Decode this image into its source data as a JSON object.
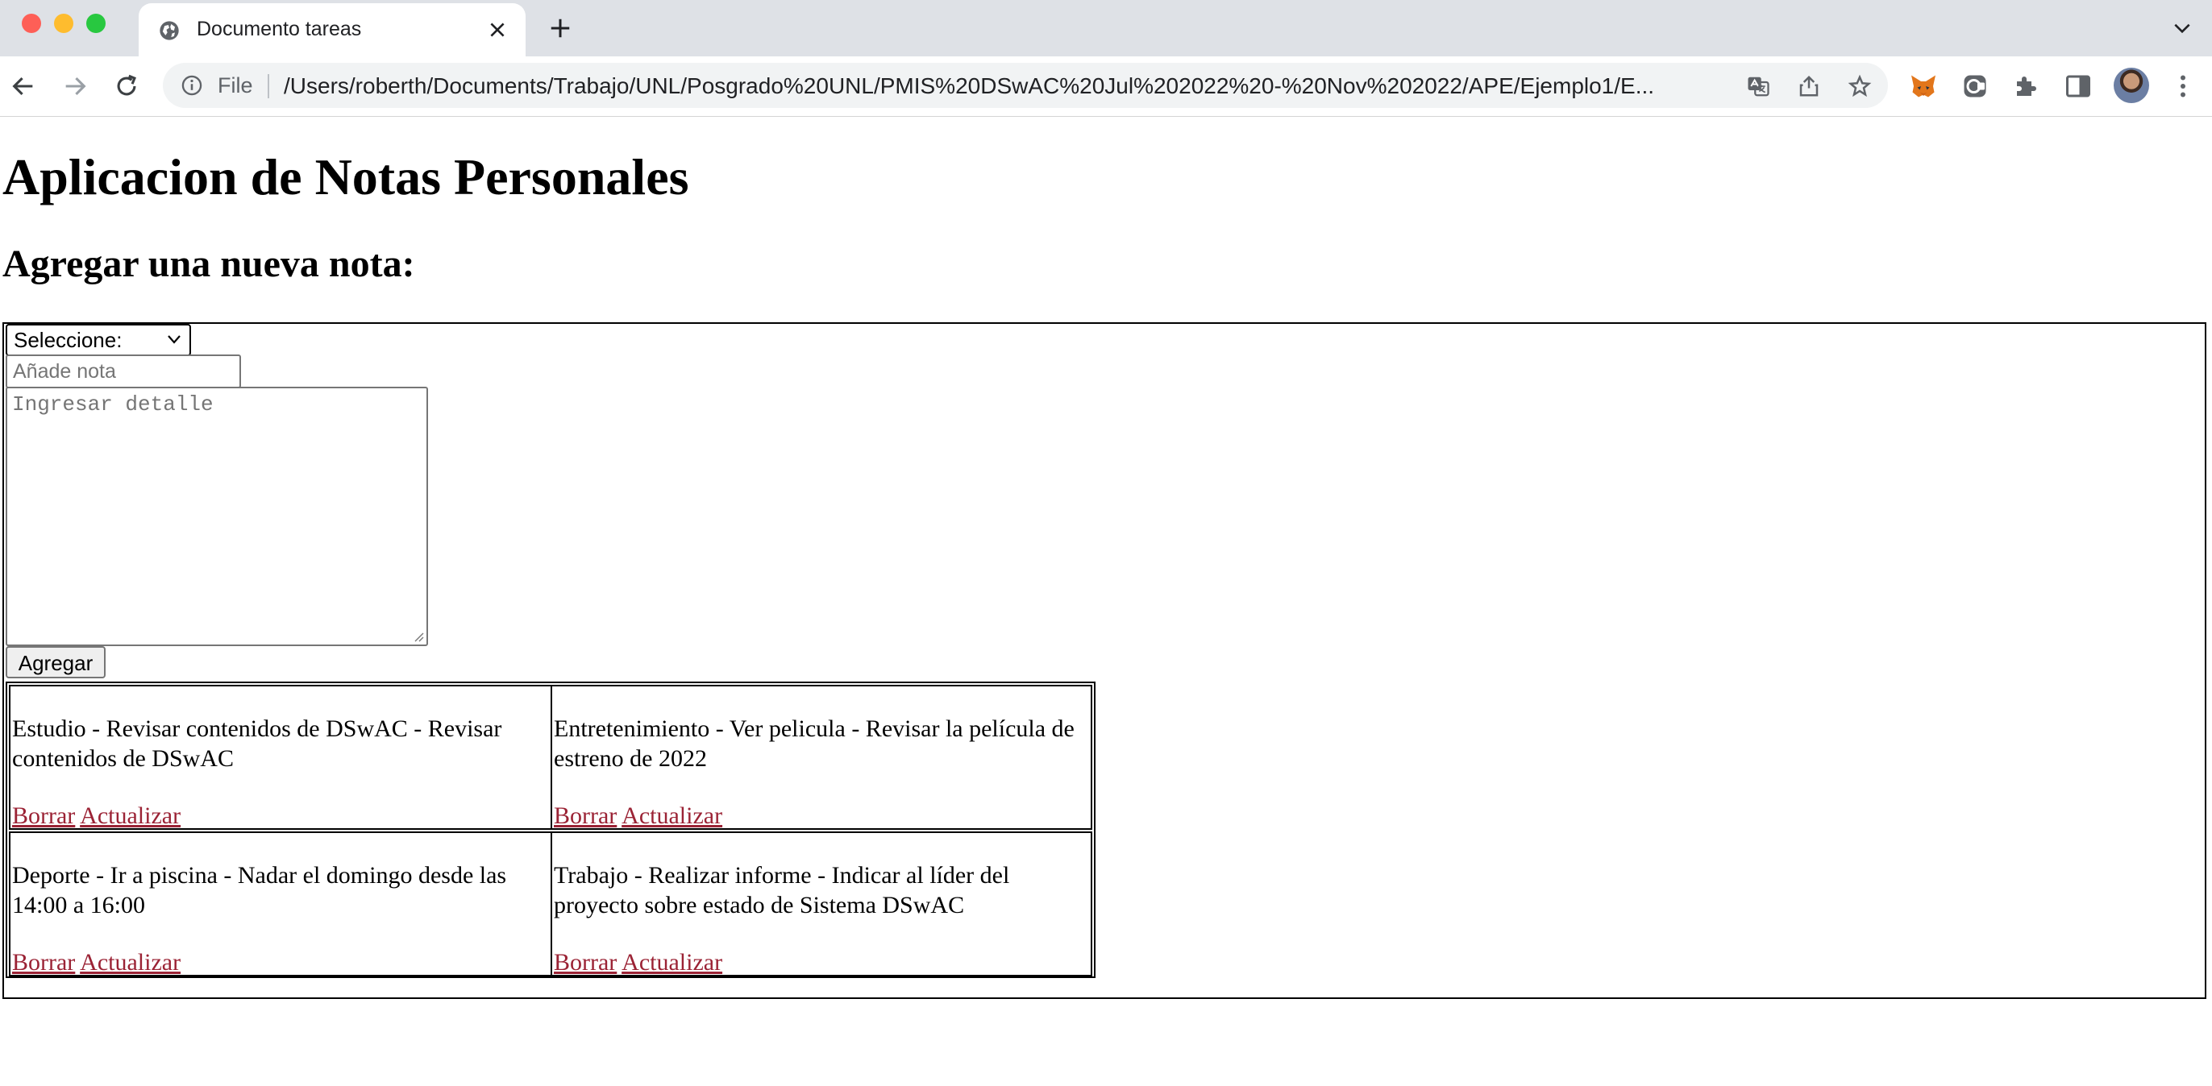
{
  "browser": {
    "tab_title": "Documento tareas",
    "file_label": "File",
    "url": "/Users/roberth/Documents/Trabajo/UNL/Posgrado%20UNL/PMIS%20DSwAC%20Jul%202022%20-%20Nov%202022/APE/Ejemplo1/E..."
  },
  "page": {
    "title": "Aplicacion de Notas Personales",
    "subtitle": "Agregar una nueva nota:"
  },
  "form": {
    "select_value": "Seleccione:",
    "note_placeholder": "Añade nota",
    "detail_placeholder": "Ingresar detalle",
    "submit_label": "Agregar"
  },
  "notes": [
    {
      "text": "Estudio - Revisar contenidos de DSwAC - Revisar contenidos de DSwAC",
      "delete_label": "Borrar",
      "update_label": "Actualizar"
    },
    {
      "text": "Entretenimiento - Ver pelicula - Revisar la película de estreno de 2022",
      "delete_label": "Borrar",
      "update_label": "Actualizar"
    },
    {
      "text": "Deporte - Ir a piscina - Nadar el domingo desde las 14:00 a 16:00",
      "delete_label": "Borrar",
      "update_label": "Actualizar"
    },
    {
      "text": "Trabajo - Realizar informe - Indicar al líder del proyecto sobre estado de Sistema DSwAC",
      "delete_label": "Borrar",
      "update_label": "Actualizar"
    }
  ],
  "colors": {
    "link": "#9b2335",
    "tabbar": "#dee1e6",
    "omnibox": "#f1f3f4"
  }
}
